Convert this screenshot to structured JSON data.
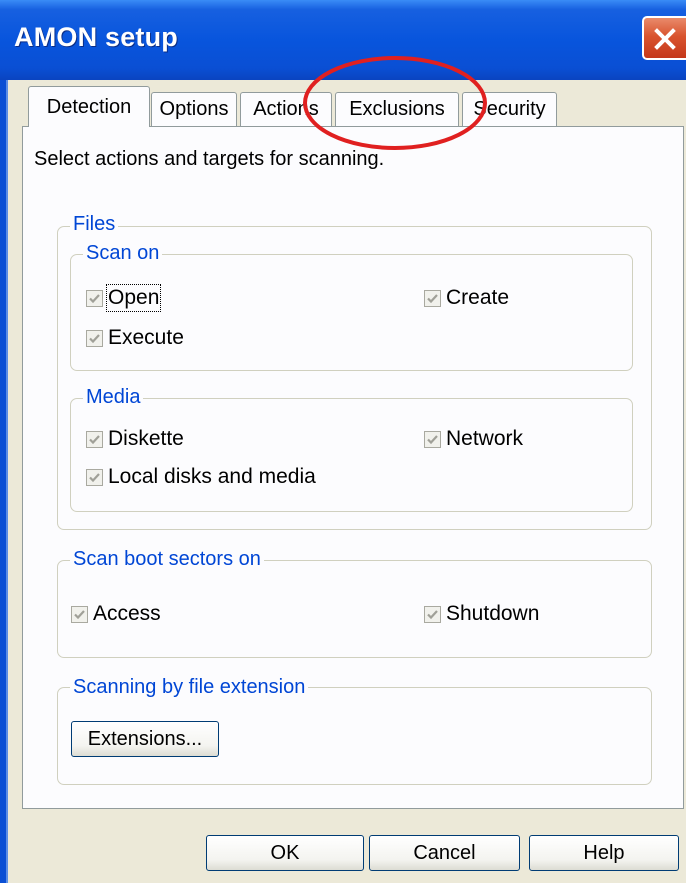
{
  "window": {
    "title": "AMON setup"
  },
  "tabs": [
    {
      "label": "Detection",
      "active": true
    },
    {
      "label": "Options",
      "active": false
    },
    {
      "label": "Actions",
      "active": false
    },
    {
      "label": "Exclusions",
      "active": false
    },
    {
      "label": "Security",
      "active": false
    }
  ],
  "instructions": "Select actions and targets for scanning.",
  "files": {
    "legend": "Files",
    "scan_on": {
      "legend": "Scan on",
      "open": "Open",
      "create": "Create",
      "execute": "Execute"
    },
    "media": {
      "legend": "Media",
      "diskette": "Diskette",
      "network": "Network",
      "local": "Local disks and media"
    }
  },
  "boot": {
    "legend": "Scan boot sectors on",
    "access": "Access",
    "shutdown": "Shutdown"
  },
  "extensions": {
    "legend": "Scanning by file extension",
    "button": "Extensions..."
  },
  "buttons": {
    "ok": "OK",
    "cancel": "Cancel",
    "help": "Help"
  },
  "colors": {
    "titlebar": "#0a4fd4",
    "groupLabel": "#0046d5",
    "annotation": "#e02020",
    "close": "#d9542f"
  },
  "icons": [
    "close-icon",
    "checkmark-icon"
  ]
}
